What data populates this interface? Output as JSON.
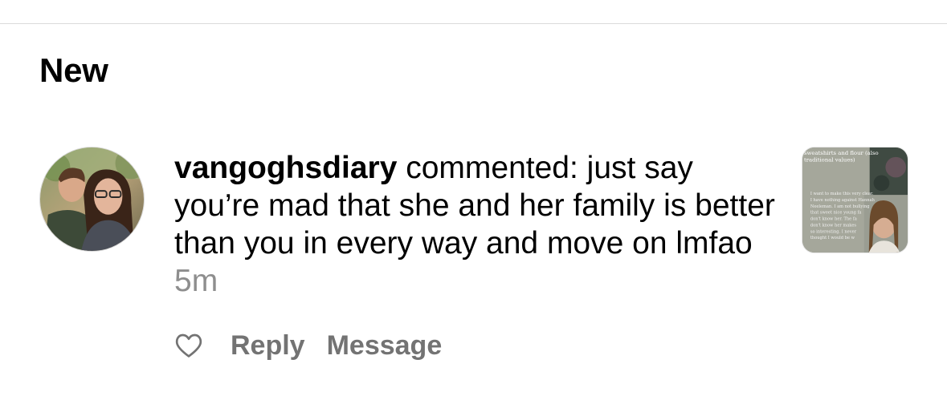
{
  "section": {
    "title": "New"
  },
  "notification": {
    "username": "vangoghsdiary",
    "message": " commented: just say you’re mad that she and her family is better than you in every way and move on lmfao",
    "time": "5m",
    "avatar_icon": "profile-photo-couple",
    "thumbnail": {
      "icon": "post-thumbnail-video",
      "caption_top": "sweatshirts and flour (also traditional values)",
      "overlay_lines": [
        "I want to make this very clear.",
        "I have nothing against Hannah",
        "Neeleman. I am not bullying",
        "that sweet nice young fa",
        "don't know her. The fa",
        "don't know her makes",
        "so interesting. I never",
        "thought I would be w"
      ]
    },
    "actions": {
      "like_icon": "heart-outline-icon",
      "reply_label": "Reply",
      "message_label": "Message"
    }
  },
  "colors": {
    "text": "#000000",
    "secondary": "#737373",
    "timestamp": "#8e8e8e",
    "divider": "#dbdbdb"
  }
}
